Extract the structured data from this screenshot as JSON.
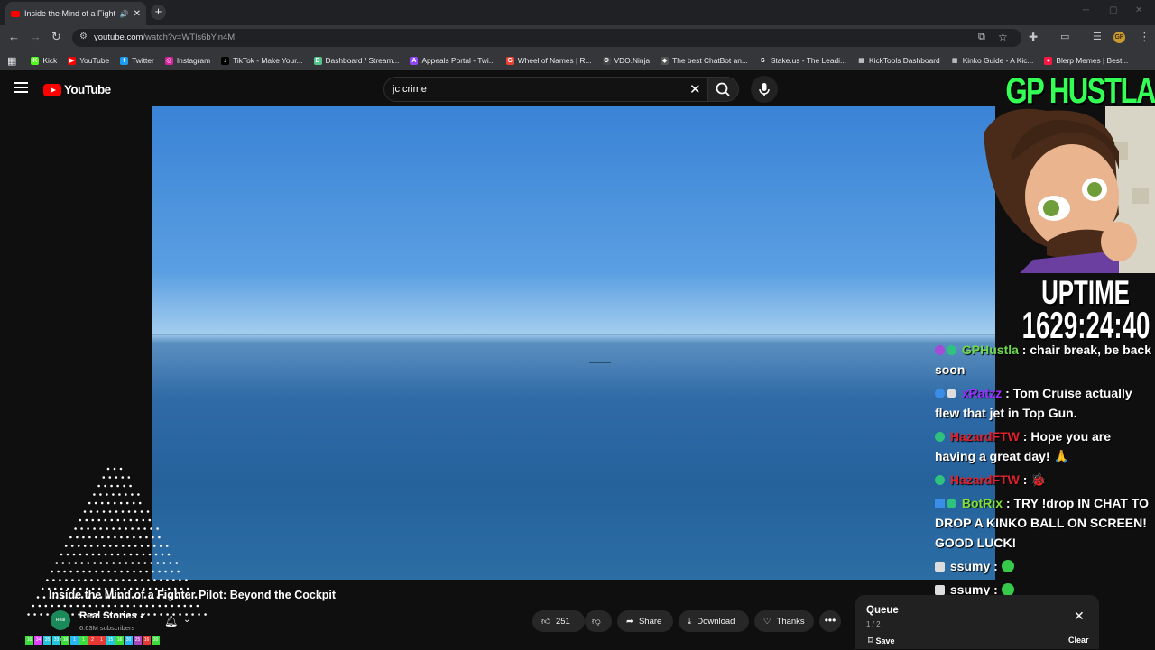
{
  "browser": {
    "tab_title": "Inside the Mind of a Fighte",
    "new_tab_label": "+",
    "url_host": "youtube.com",
    "url_path": "/watch?v=WTls6bYin4M",
    "profile_initial": "GP",
    "bookmarks": [
      {
        "label": "Kick",
        "color": "#53fc18",
        "glyph": "K"
      },
      {
        "label": "YouTube",
        "color": "#ff0000",
        "glyph": "▶"
      },
      {
        "label": "Twitter",
        "color": "#1d9bf0",
        "glyph": "t"
      },
      {
        "label": "Instagram",
        "color": "#d6249f",
        "glyph": "◎"
      },
      {
        "label": "TikTok - Make Your...",
        "color": "#000000",
        "glyph": "♪"
      },
      {
        "label": "Dashboard / Stream...",
        "color": "#53c58c",
        "glyph": "D"
      },
      {
        "label": "Appeals Portal - Twi...",
        "color": "#9146ff",
        "glyph": "A"
      },
      {
        "label": "Wheel of Names | R...",
        "color": "#ea4335",
        "glyph": "G"
      },
      {
        "label": "VDO.Ninja",
        "color": "#444444",
        "glyph": "✪"
      },
      {
        "label": "The best ChatBot an...",
        "color": "#555555",
        "glyph": "◆"
      },
      {
        "label": "Stake.us - The Leadi...",
        "color": "#35363a",
        "glyph": "S"
      },
      {
        "label": "KickTools Dashboard",
        "color": "#35363a",
        "glyph": "▦"
      },
      {
        "label": "Kinko Guide - A Kic...",
        "color": "#35363a",
        "glyph": "▦"
      },
      {
        "label": "Blerp Memes | Best...",
        "color": "#ff1744",
        "glyph": "●"
      }
    ]
  },
  "youtube": {
    "logo_text": "YouTube",
    "search_value": "jc crime",
    "video_title": "Inside the Mind of a Fighter Pilot: Beyond the Cockpit",
    "channel_name": "Real Stories",
    "channel_avatar_text": "Real Stories",
    "subscribers": "6.63M subscribers",
    "likes": "251",
    "share_label": "Share",
    "download_label": "Download",
    "thanks_label": "Thanks",
    "more_label": "•••",
    "queue": {
      "title": "Queue",
      "count": "1 / 2",
      "save_label": "Save",
      "clear_label": "Clear"
    }
  },
  "stream_overlay": {
    "title": "GP HUSTLA",
    "uptime_label": "UPTIME",
    "uptime_value": "1629:24:40",
    "chat": [
      {
        "user": "GPHustla",
        "color": "#6ed84f",
        "text": "chair break, be back soon"
      },
      {
        "user": "xRatzz",
        "color": "#9b30ff",
        "text": "Tom Cruise actually flew that jet in Top Gun."
      },
      {
        "user": "HazardFTW",
        "color": "#e0212d",
        "text": "Hope you are having a great day! 🙏"
      },
      {
        "user": "HazardFTW",
        "color": "#e0212d",
        "text": "🐞"
      },
      {
        "user": "BotRix",
        "color": "#7ee03b",
        "text": "TRY !drop IN CHAT TO DROP A KINKO BALL ON SCREEN! GOOD LUCK!"
      },
      {
        "user": "ssumy",
        "color": "#ffffff",
        "text": ""
      },
      {
        "user": "ssumy",
        "color": "#ffffff",
        "text": ""
      },
      {
        "user": "ssumy",
        "color": "#ffffff",
        "text": ""
      },
      {
        "user": "ssumy",
        "color": "#ffffff",
        "text": ""
      }
    ]
  },
  "colorbar": [
    "16",
    "34",
    "35",
    "33",
    "16",
    "1",
    "1",
    "2",
    "1",
    "15",
    "16",
    "30",
    "25",
    "16",
    "20"
  ]
}
